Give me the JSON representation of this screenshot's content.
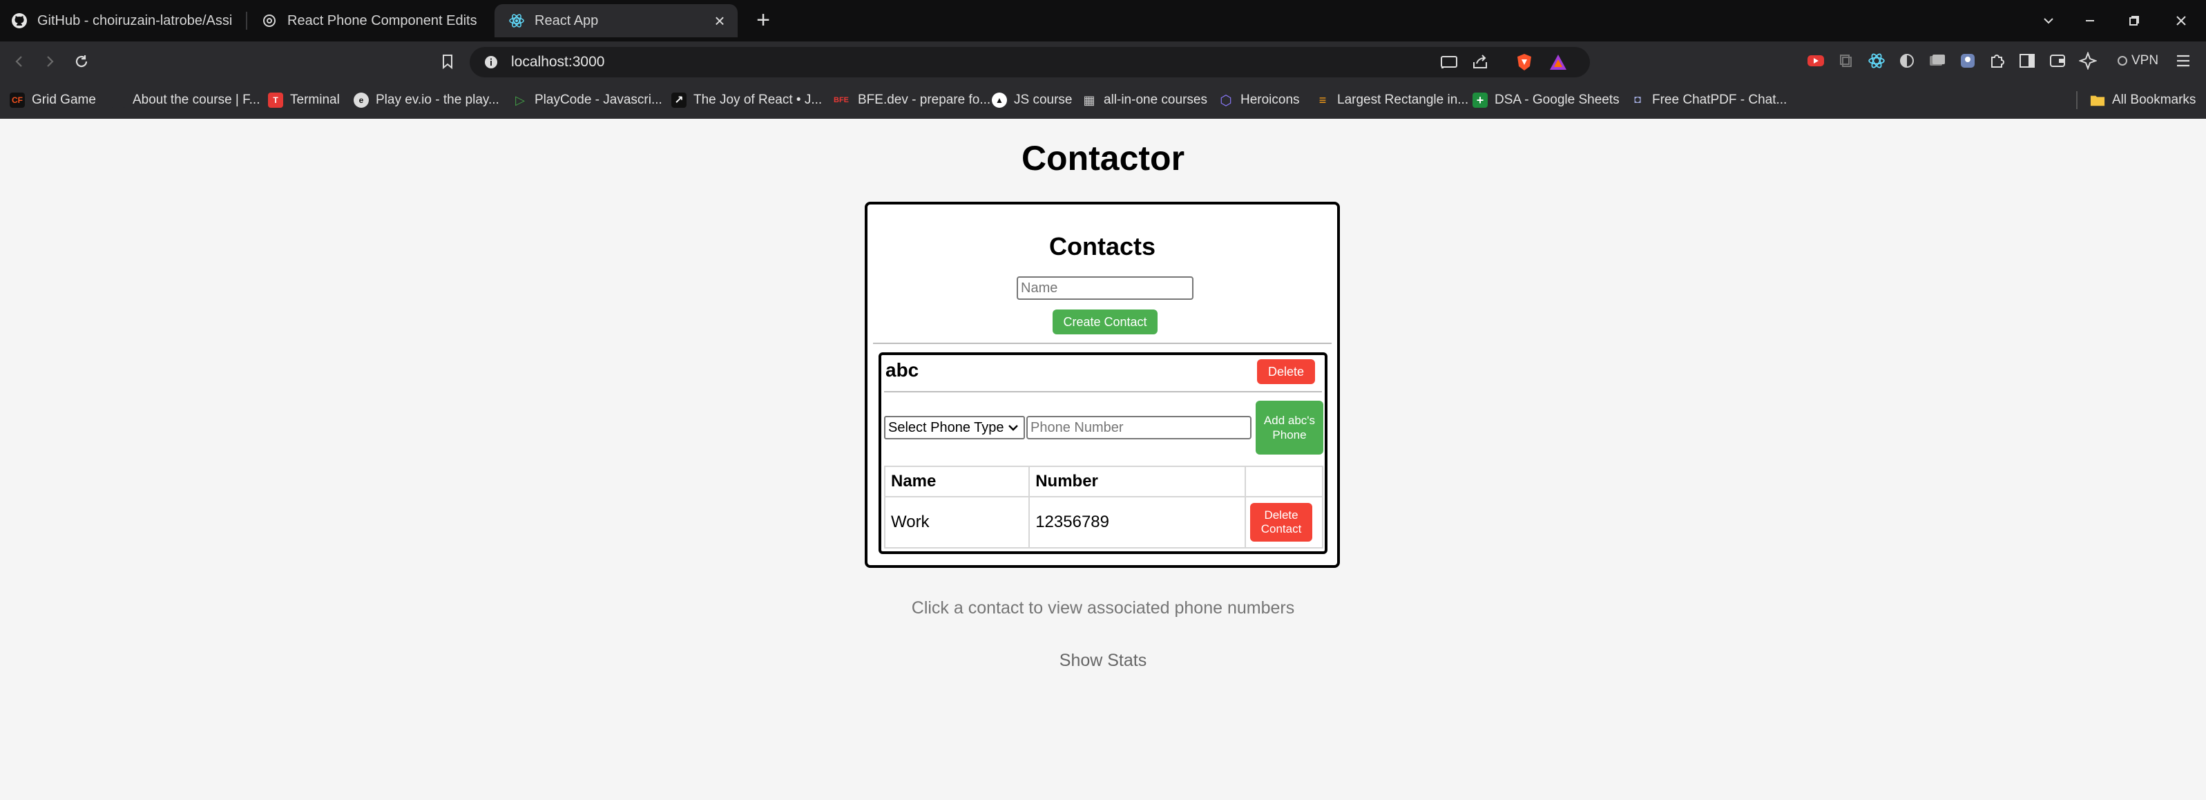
{
  "browser": {
    "tabs": [
      {
        "label": "GitHub - choiruzain-latrobe/Assignm",
        "icon": "github-icon"
      },
      {
        "label": "React Phone Component Edits",
        "icon": "chatgpt-icon"
      },
      {
        "label": "React App",
        "icon": "react-icon",
        "active": true
      }
    ],
    "url": "localhost:3000",
    "vpn_label": "VPN",
    "bookmarks": [
      {
        "label": "Grid Game",
        "icon": "CF",
        "color": "#d32f2f"
      },
      {
        "label": "About the course | F...",
        "icon": "",
        "color": "#222"
      },
      {
        "label": "Terminal",
        "icon": "T",
        "color": "#e53935"
      },
      {
        "label": "Play ev.io - the play...",
        "icon": "e",
        "color": "#555"
      },
      {
        "label": "PlayCode - Javascri...",
        "icon": "▷",
        "color": "#2e7d32"
      },
      {
        "label": "The Joy of React • J...",
        "icon": "↗",
        "color": "#111"
      },
      {
        "label": "BFE.dev - prepare fo...",
        "icon": "BFE",
        "color": "#c62828"
      },
      {
        "label": "JS course",
        "icon": "▲",
        "color": "#111"
      },
      {
        "label": "all-in-one courses",
        "icon": "▦",
        "color": "#666"
      },
      {
        "label": "Heroicons",
        "icon": "⬡",
        "color": "#7c4dff"
      },
      {
        "label": "Largest Rectangle in...",
        "icon": "≡",
        "color": "#ef8f00"
      },
      {
        "label": "DSA - Google Sheets",
        "icon": "+",
        "color": "#1e8e3e"
      },
      {
        "label": "Free ChatPDF - Chat...",
        "icon": "◘",
        "color": "#5c6bc0"
      }
    ],
    "all_bookmarks_label": "All Bookmarks"
  },
  "app": {
    "title": "Contactor",
    "contacts_heading": "Contacts",
    "name_placeholder": "Name",
    "create_label": "Create Contact",
    "contact": {
      "name": "abc",
      "delete_label": "Delete",
      "phone_type_selected": "Select Phone Type",
      "phone_placeholder": "Phone Number",
      "add_phone_label": "Add abc's Phone",
      "table_headers": {
        "name": "Name",
        "number": "Number"
      },
      "phones": [
        {
          "name": "Work",
          "number": "12356789",
          "action_label": "Delete Contact"
        }
      ]
    },
    "hint": "Click a contact to view associated phone numbers",
    "stats_label": "Show Stats"
  },
  "colors": {
    "green": "#4caf50",
    "red": "#f44336",
    "page_bg": "#f5f5f5",
    "chrome_dark": "#0f0f10",
    "chrome_toolbar": "#2b2b2e"
  }
}
